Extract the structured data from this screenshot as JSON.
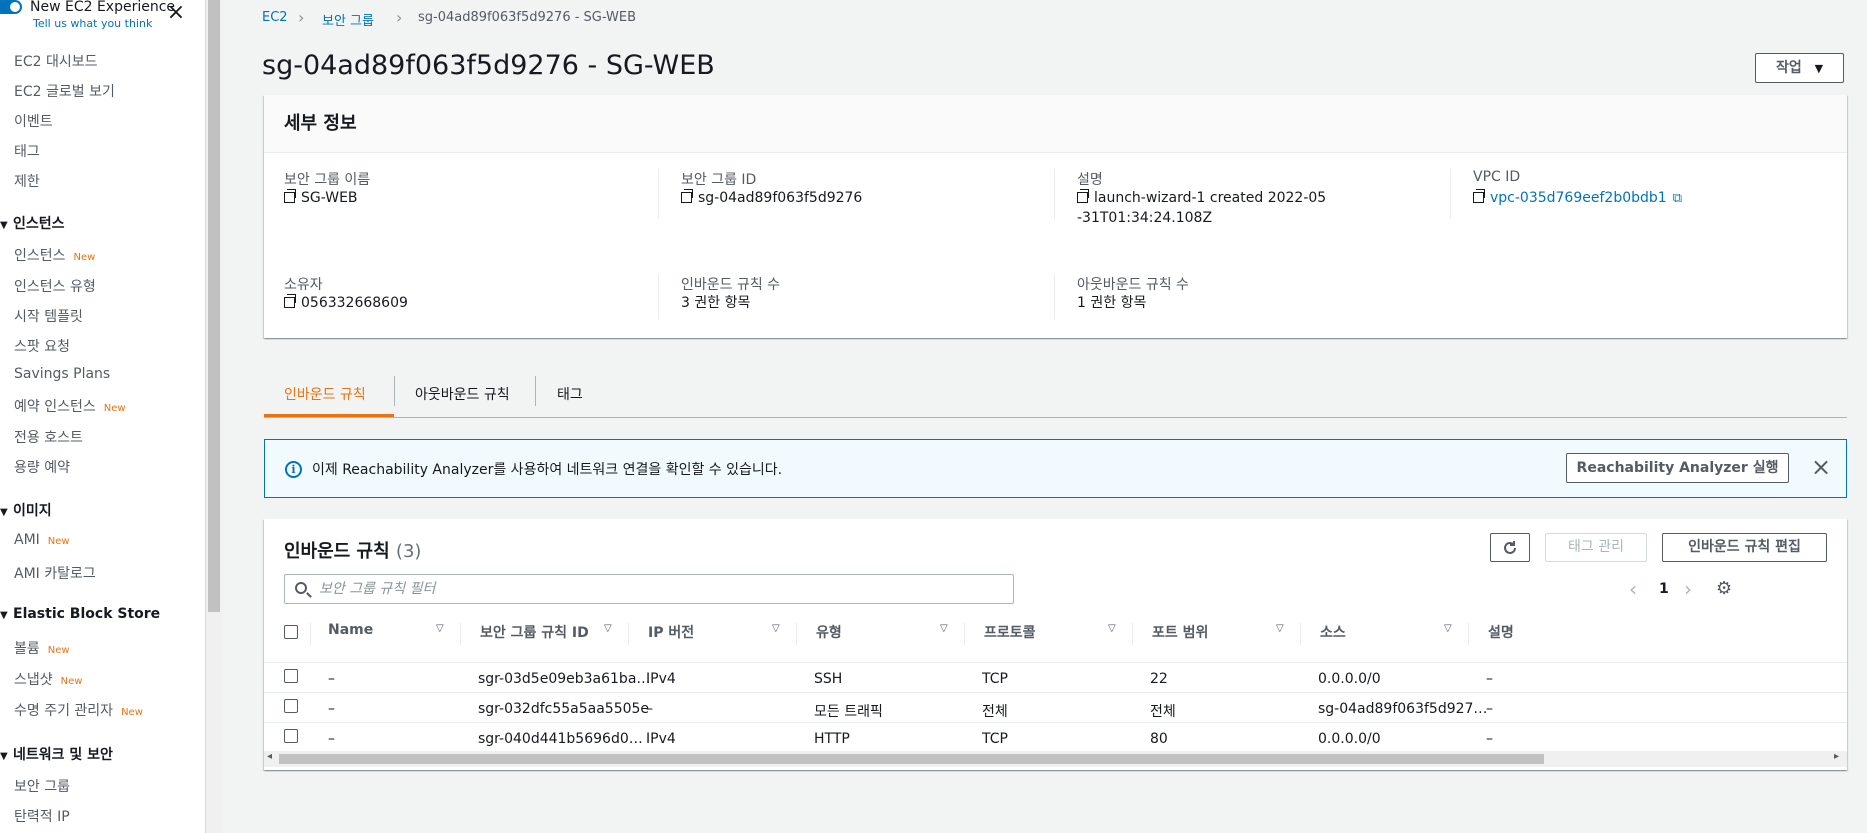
{
  "sidebar": {
    "new_exp_title": "New EC2 Experience",
    "new_exp_sub": "Tell us what you think",
    "new_badge": "New",
    "items": [
      {
        "label": "EC2 대시보드"
      },
      {
        "label": "EC2 글로벌 보기"
      },
      {
        "label": "이벤트"
      },
      {
        "label": "태그"
      },
      {
        "label": "제한"
      }
    ],
    "sections": [
      {
        "title": "인스턴스",
        "items": [
          "인스턴스",
          "인스턴스 유형",
          "시작 템플릿",
          "스팟 요청",
          "Savings Plans",
          "예약 인스턴스",
          "전용 호스트",
          "용량 예약"
        ]
      },
      {
        "title": "이미지",
        "items": [
          "AMI",
          "AMI 카탈로그"
        ]
      },
      {
        "title": "Elastic Block Store",
        "items": [
          "볼륨",
          "스냅샷",
          "수명 주기 관리자"
        ]
      },
      {
        "title": "네트워크 및 보안",
        "items": [
          "보안 그룹",
          "탄력적 IP"
        ]
      }
    ]
  },
  "breadcrumb": {
    "ec2": "EC2",
    "sg": "보안 그룹",
    "current": "sg-04ad89f063f5d9276 - SG-WEB"
  },
  "page_title": "sg-04ad89f063f5d9276 - SG-WEB",
  "actions_label": "작업",
  "details": {
    "title": "세부 정보",
    "sg_name_label": "보안 그룹 이름",
    "sg_name": "SG-WEB",
    "sg_id_label": "보안 그룹 ID",
    "sg_id": "sg-04ad89f063f5d9276",
    "desc_label": "설명",
    "desc": "launch-wizard-1 created 2022-05-31T01:34:24.108Z",
    "vpc_label": "VPC ID",
    "vpc": "vpc-035d769eef2b0bdb1",
    "owner_label": "소유자",
    "owner": "056332668609",
    "inbound_count_label": "인바운드 규칙 수",
    "inbound_count": "3 권한 항목",
    "outbound_count_label": "아웃바운드 규칙 수",
    "outbound_count": "1 권한 항목"
  },
  "tabs": [
    "인바운드 규칙",
    "아웃바운드 규칙",
    "태그"
  ],
  "alert": {
    "text": "이제 Reachability Analyzer를 사용하여 네트워크 연결을 확인할 수 있습니다.",
    "button": "Reachability Analyzer 실행"
  },
  "rules": {
    "title": "인바운드 규칙",
    "count": "(3)",
    "manage_tags": "태그 관리",
    "edit": "인바운드 규칙 편집",
    "search_placeholder": "보안 그룹 규칙 필터",
    "page": "1",
    "columns": [
      "Name",
      "보안 그룹 규칙 ID",
      "IP 버전",
      "유형",
      "프로토콜",
      "포트 범위",
      "소스",
      "설명"
    ],
    "rows": [
      [
        "–",
        "sgr-03d5e09eb3a61ba…",
        "IPv4",
        "SSH",
        "TCP",
        "22",
        "0.0.0.0/0",
        "–"
      ],
      [
        "–",
        "sgr-032dfc55a5aa5505e",
        "–",
        "모든 트래픽",
        "전체",
        "전체",
        "sg-04ad89f063f5d927…",
        "–"
      ],
      [
        "–",
        "sgr-040d441b5696d0…",
        "IPv4",
        "HTTP",
        "TCP",
        "80",
        "0.0.0.0/0",
        "–"
      ]
    ]
  },
  "colors": {
    "accent": "#ec7211",
    "link": "#0073bb"
  }
}
